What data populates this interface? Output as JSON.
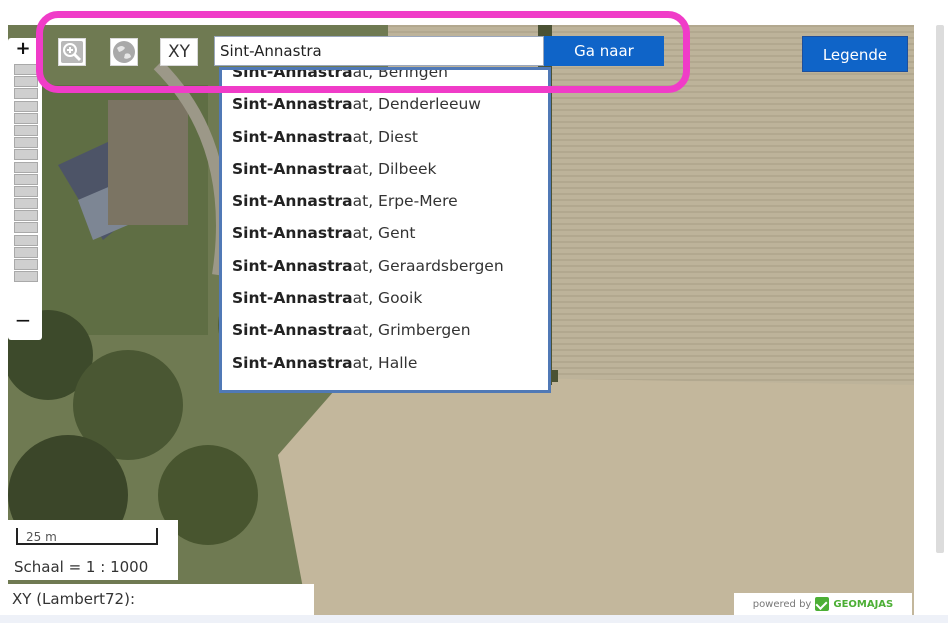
{
  "toolbar": {
    "zoom_in_symbol": "+",
    "xy_label": "XY",
    "search_value": "Sint-Annastra",
    "go_label": "Ga naar",
    "legend_label": "Legende"
  },
  "suggestions": {
    "match": "Sint-Annastra",
    "items": [
      {
        "bold": "Sint-Annastra",
        "rest": "at, Beringen"
      },
      {
        "bold": "Sint-Annastra",
        "rest": "at, Denderleeuw"
      },
      {
        "bold": "Sint-Annastra",
        "rest": "at, Diest"
      },
      {
        "bold": "Sint-Annastra",
        "rest": "at, Dilbeek"
      },
      {
        "bold": "Sint-Annastra",
        "rest": "at, Erpe-Mere"
      },
      {
        "bold": "Sint-Annastra",
        "rest": "at, Gent"
      },
      {
        "bold": "Sint-Annastra",
        "rest": "at, Geraardsbergen"
      },
      {
        "bold": "Sint-Annastra",
        "rest": "at, Gooik"
      },
      {
        "bold": "Sint-Annastra",
        "rest": "at, Grimbergen"
      },
      {
        "bold": "Sint-Annastra",
        "rest": "at, Halle"
      }
    ]
  },
  "zoom": {
    "in_label": "+",
    "out_label": "−"
  },
  "scale": {
    "length": "25 m",
    "ratio": "Schaal = 1 : 1000"
  },
  "coordinates": {
    "label": "XY (Lambert72):"
  },
  "footer": {
    "powered_by": "powered by",
    "brand": "GEOMAJAS"
  },
  "colors": {
    "button_blue": "#0f64c8",
    "highlight_pink": "#f03cc8",
    "dropdown_border": "#5079b6"
  }
}
